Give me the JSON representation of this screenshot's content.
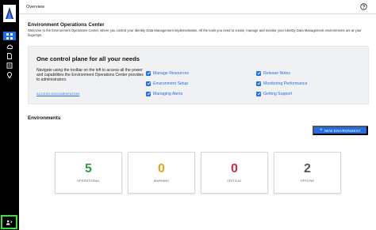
{
  "header": {
    "breadcrumb": "Overview",
    "help_icon": "help-circle-icon"
  },
  "sidebar": {
    "logo_icon": "product-logo-icon",
    "items": [
      {
        "icon": "dashboard-grid-icon",
        "active": true
      },
      {
        "icon": "cloud-icon",
        "active": false
      },
      {
        "icon": "document-icon",
        "active": false
      },
      {
        "icon": "report-icon",
        "active": false
      },
      {
        "icon": "lightbulb-icon",
        "active": false
      }
    ],
    "bottom_icon": "user-switch-icon"
  },
  "intro": {
    "title": "Environment Operations Center",
    "text": "Welcome to the Environment Operations Center, where you control your Identity Data Management implementation. All the tools you need to create, manage and monitor your Identity Data Management environments are at your fingertips."
  },
  "promo": {
    "headline": "One control plane for all your needs",
    "description": "Navigate using the toolbar on the left to access all the power and capabilities the Environment Operations Center provides to administrators.",
    "docs_link": "ACCESS DOCUMENTATION",
    "checklist_left": [
      "Manage Resources",
      "Environment Setup",
      "Managing Alerts"
    ],
    "checklist_right": [
      "Release Notes",
      "Monitoring Performance",
      "Getting Support"
    ]
  },
  "environments": {
    "title": "Environments",
    "new_button": "NEW ENVIRONMENT",
    "stats": [
      {
        "value": "5",
        "label": "OPERATIONAL"
      },
      {
        "value": "0",
        "label": "WARNING"
      },
      {
        "value": "0",
        "label": "CRITICAL"
      },
      {
        "value": "2",
        "label": "OFFLINE"
      }
    ]
  },
  "colors": {
    "accent": "#1f6feb",
    "operational": "#2e9c3f",
    "warning": "#e3a21a",
    "critical": "#d3264a",
    "offline": "#555555",
    "rail": "#000000",
    "highlight": "#3ddc3d"
  }
}
